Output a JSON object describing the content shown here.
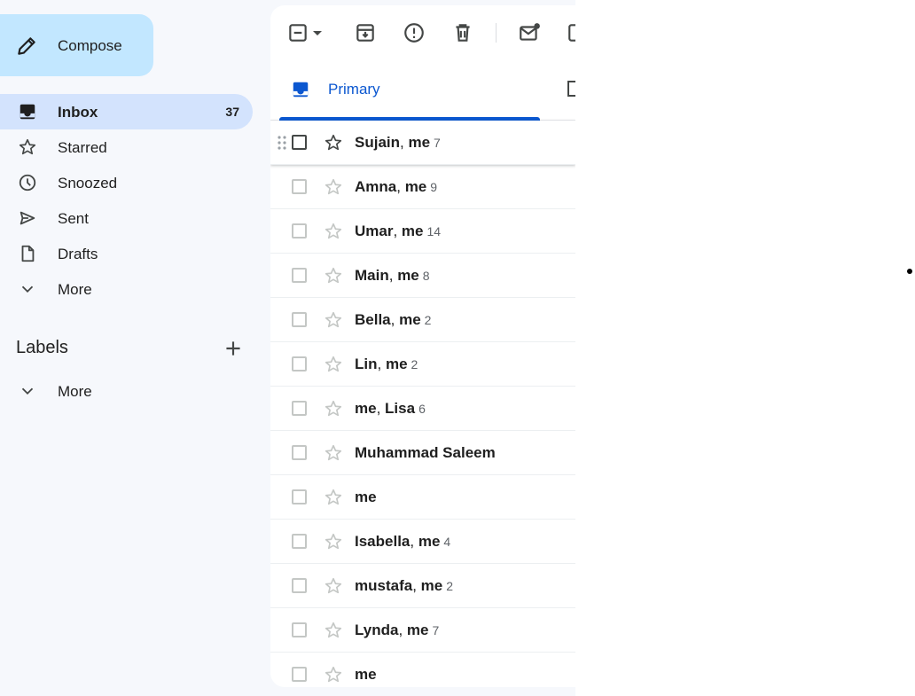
{
  "compose": {
    "label": "Compose",
    "icon": "pencil-icon"
  },
  "nav": [
    {
      "label": "Inbox",
      "icon": "inbox-icon",
      "count": "37",
      "active": true
    },
    {
      "label": "Starred",
      "icon": "star-icon"
    },
    {
      "label": "Snoozed",
      "icon": "clock-icon"
    },
    {
      "label": "Sent",
      "icon": "send-icon"
    },
    {
      "label": "Drafts",
      "icon": "draft-icon"
    },
    {
      "label": "More",
      "icon": "chevron-down-icon"
    }
  ],
  "labels": {
    "title": "Labels",
    "more": "More"
  },
  "toolbar": {
    "icons": [
      "select-checkbox-icon",
      "dropdown-caret-icon",
      "archive-icon",
      "report-spam-icon",
      "delete-icon",
      "mark-unread-icon",
      "snooze-icon"
    ]
  },
  "tabs": {
    "primary": "Primary",
    "next_icon": "tag-icon"
  },
  "emails": [
    {
      "names": [
        "Sujain",
        "me"
      ],
      "count": "7"
    },
    {
      "names": [
        "Amna",
        "me"
      ],
      "count": "9"
    },
    {
      "names": [
        "Umar",
        "me"
      ],
      "count": "14"
    },
    {
      "names": [
        "Main",
        "me"
      ],
      "count": "8"
    },
    {
      "names": [
        "Bella",
        "me"
      ],
      "count": "2"
    },
    {
      "names": [
        "Lin",
        "me"
      ],
      "count": "2"
    },
    {
      "names": [
        "me",
        "Lisa"
      ],
      "count": "6"
    },
    {
      "names": [
        "Muhammad Saleem"
      ],
      "count": ""
    },
    {
      "names": [
        "me"
      ],
      "count": ""
    },
    {
      "names": [
        "Isabella",
        "me"
      ],
      "count": "4"
    },
    {
      "names": [
        "mustafa",
        "me"
      ],
      "count": "2"
    },
    {
      "names": [
        "Lynda",
        "me"
      ],
      "count": "7"
    },
    {
      "names": [
        "me"
      ],
      "count": ""
    }
  ],
  "colors": {
    "sidebar_bg": "#f6f8fc",
    "compose_bg": "#c2e7ff",
    "active_nav": "#d3e3fd",
    "accent": "#0b57d0"
  }
}
